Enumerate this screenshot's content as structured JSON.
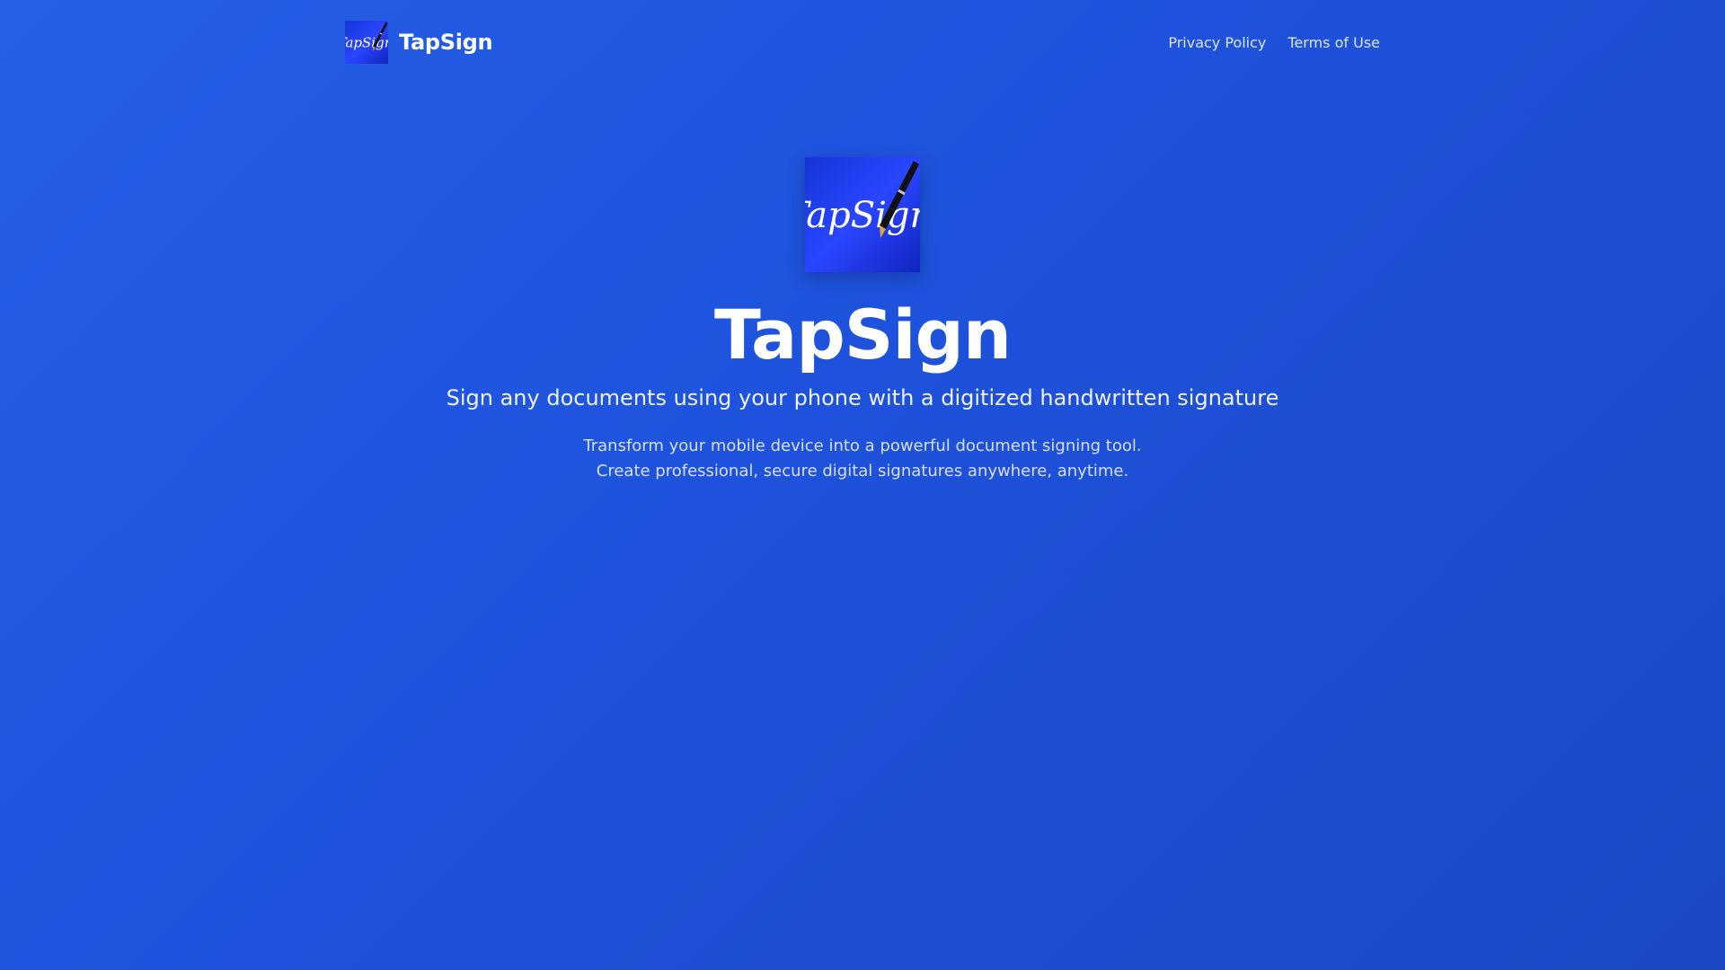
{
  "app": {
    "name": "TapSign",
    "logo_text": "TapSign"
  },
  "header": {
    "brand_name": "TapSign",
    "nav": [
      {
        "label": "Privacy Policy"
      },
      {
        "label": "Terms of Use"
      }
    ]
  },
  "hero": {
    "title": "TapSign",
    "tagline": "Sign any documents using your phone with a digitized handwritten signature",
    "description": "Transform your mobile device into a powerful document signing tool. Create professional, secure digital signatures anywhere, anytime."
  },
  "colors": {
    "background_start": "#2560e6",
    "background_end": "#1c48c6",
    "logo_tile": "#1f3df5",
    "text": "#ffffff"
  },
  "icons": {
    "logo": "pen-signature-icon"
  }
}
